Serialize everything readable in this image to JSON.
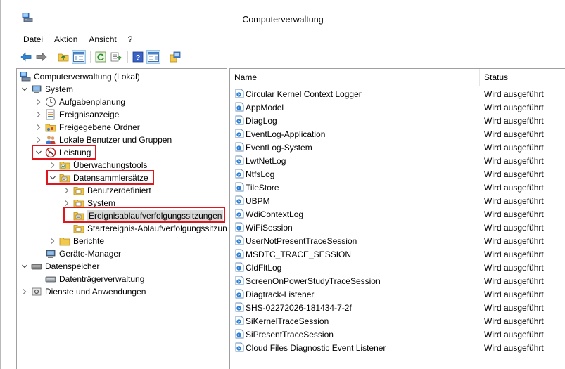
{
  "window": {
    "title": "Computerverwaltung"
  },
  "menu": [
    "Datei",
    "Aktion",
    "Ansicht",
    "?"
  ],
  "toolbar": {
    "buttons": [
      "back-arrow-icon",
      "forward-arrow-icon",
      "folder-up-icon",
      "show-hide-tree-icon",
      "refresh-icon",
      "export-list-icon",
      "help-icon",
      "properties-pane-icon",
      "mmc-snapin-icon"
    ]
  },
  "tree": {
    "root": "Computerverwaltung (Lokal)",
    "system": "System",
    "aufgabenplanung": "Aufgabenplanung",
    "ereignisanzeige": "Ereignisanzeige",
    "freigegebene_ordner": "Freigegebene Ordner",
    "lokale_benutzer": "Lokale Benutzer und Gruppen",
    "leistung": "Leistung",
    "ueberwachungstools": "Überwachungstools",
    "datensammlersaetze": "Datensammlersätze",
    "benutzerdefiniert": "Benutzerdefiniert",
    "system_dcs": "System",
    "ereignisablauf": "Ereignisablaufverfolgungssitzungen",
    "startereignis": "Startereignis-Ablaufverfolgungssitzungen",
    "berichte": "Berichte",
    "geraete_manager": "Geräte-Manager",
    "datenspeicher": "Datenspeicher",
    "datentraeger": "Datenträgerverwaltung",
    "dienste": "Dienste und Anwendungen"
  },
  "list": {
    "columns": {
      "name": "Name",
      "status": "Status"
    },
    "rows": [
      {
        "name": "Circular Kernel Context Logger",
        "status": "Wird ausgeführt"
      },
      {
        "name": "AppModel",
        "status": "Wird ausgeführt"
      },
      {
        "name": "DiagLog",
        "status": "Wird ausgeführt"
      },
      {
        "name": "EventLog-Application",
        "status": "Wird ausgeführt"
      },
      {
        "name": "EventLog-System",
        "status": "Wird ausgeführt"
      },
      {
        "name": "LwtNetLog",
        "status": "Wird ausgeführt"
      },
      {
        "name": "NtfsLog",
        "status": "Wird ausgeführt"
      },
      {
        "name": "TileStore",
        "status": "Wird ausgeführt"
      },
      {
        "name": "UBPM",
        "status": "Wird ausgeführt"
      },
      {
        "name": "WdiContextLog",
        "status": "Wird ausgeführt"
      },
      {
        "name": "WiFiSession",
        "status": "Wird ausgeführt"
      },
      {
        "name": "UserNotPresentTraceSession",
        "status": "Wird ausgeführt"
      },
      {
        "name": "MSDTC_TRACE_SESSION",
        "status": "Wird ausgeführt"
      },
      {
        "name": "CldFltLog",
        "status": "Wird ausgeführt"
      },
      {
        "name": "ScreenOnPowerStudyTraceSession",
        "status": "Wird ausgeführt"
      },
      {
        "name": "Diagtrack-Listener",
        "status": "Wird ausgeführt"
      },
      {
        "name": "SHS-02272026-181434-7-2f",
        "status": "Wird ausgeführt"
      },
      {
        "name": "SiKernelTraceSession",
        "status": "Wird ausgeführt"
      },
      {
        "name": "SiPresentTraceSession",
        "status": "Wird ausgeführt"
      },
      {
        "name": "Cloud Files Diagnostic Event Listener",
        "status": "Wird ausgeführt"
      }
    ]
  },
  "colors": {
    "highlight_box": "#e0161e",
    "selection": "#d9d9d9",
    "trace_icon_blue": "#2a7fd4"
  }
}
